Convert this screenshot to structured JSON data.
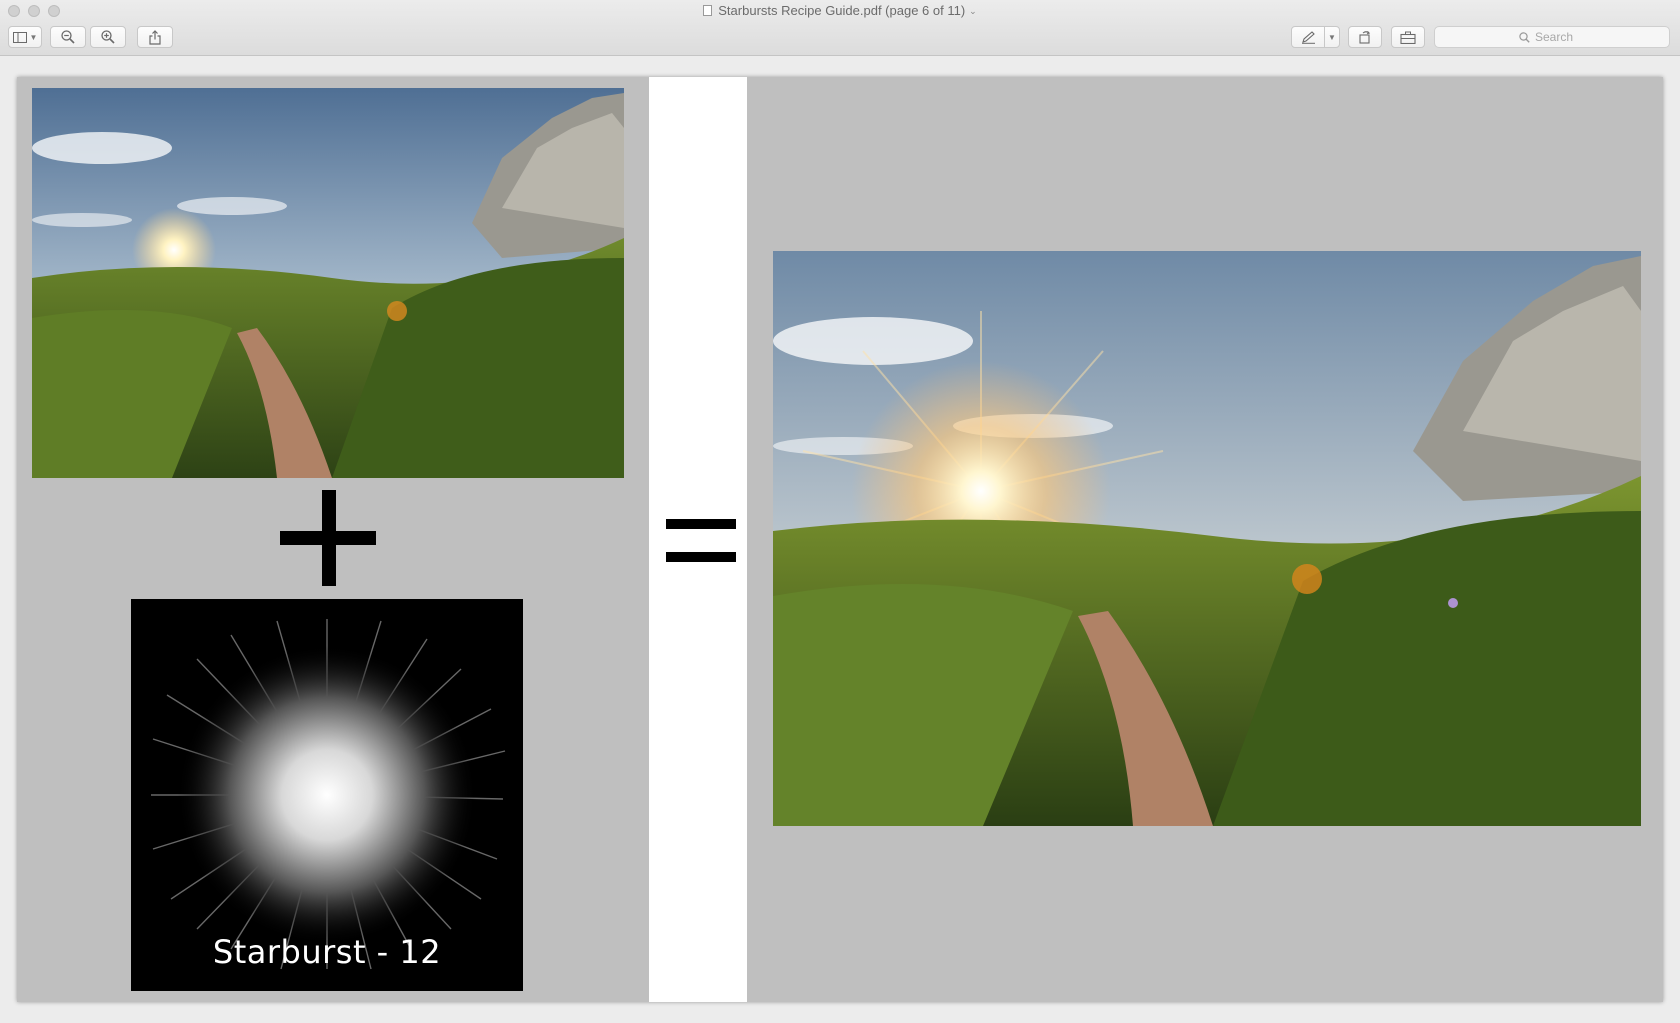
{
  "window": {
    "title": "Starbursts Recipe Guide.pdf (page 6 of 11)"
  },
  "toolbar": {
    "sidebar_icon": "sidebar-icon",
    "zoom_out_icon": "zoom-out-icon",
    "zoom_in_icon": "zoom-in-icon",
    "share_icon": "share-icon",
    "markup_icon": "pen-icon",
    "rotate_icon": "rotate-icon",
    "toolbox_icon": "toolbox-icon"
  },
  "search": {
    "placeholder": "Search"
  },
  "page": {
    "plus_symbol": "+",
    "equals_symbol": "=",
    "starburst_label": "Starburst - 12",
    "colors": {
      "page_bg": "#bfbfbf",
      "divider_bg": "#ffffff",
      "symbol": "#000000"
    }
  }
}
